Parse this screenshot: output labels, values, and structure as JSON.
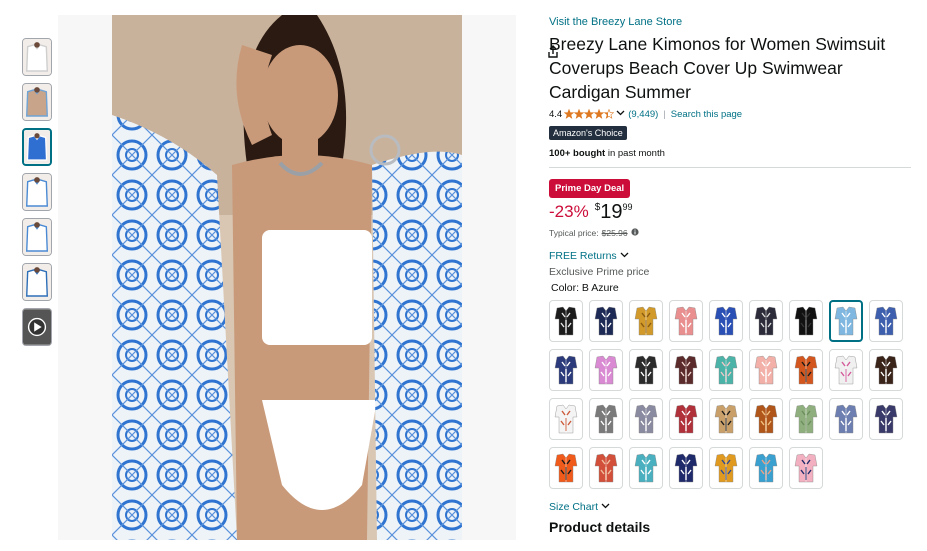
{
  "store_link": "Visit the Breezy Lane Store",
  "title": "Breezy Lane Kimonos for Women Swimsuit Coverups Beach Cover Up Swimwear Cardigan Summer",
  "rating": {
    "value": "4.4",
    "stars": 4.4,
    "count": "(9,449)",
    "search_link": "Search this page"
  },
  "badge": "Amazon's Choice",
  "bought": {
    "bold": "100+ bought",
    "rest": " in past month"
  },
  "deal_badge": "Prime Day Deal",
  "price": {
    "discount": "-23%",
    "currency": "$",
    "whole": "19",
    "fraction": "99"
  },
  "typical": {
    "label": "Typical price:",
    "value": "$25.96"
  },
  "returns": "FREE Returns",
  "exclusive": "Exclusive Prime price",
  "color_label": "Color: B Azure",
  "size_chart": "Size Chart",
  "product_details": "Product details",
  "colors": {
    "brand_link": "#007185",
    "deal_red": "#cc0c39",
    "choice_bg": "#232f3e",
    "star": "#de7921"
  },
  "thumbnails": [
    {
      "name": "thumb-1",
      "main": "#ffffff",
      "accent": "#cfcfcf"
    },
    {
      "name": "thumb-2",
      "main": "#c8a58a",
      "accent": "#6fa3d6"
    },
    {
      "name": "thumb-3",
      "main": "#2f6fd1",
      "accent": "#ffffff",
      "active": true
    },
    {
      "name": "thumb-4",
      "main": "#ffffff",
      "accent": "#4a8ad4"
    },
    {
      "name": "thumb-5",
      "main": "#ffffff",
      "accent": "#4a8ad4"
    },
    {
      "name": "thumb-6",
      "main": "#ffffff",
      "accent": "#2d6eb8"
    },
    {
      "name": "thumb-video",
      "main": "#555555",
      "accent": "#ffffff",
      "video": true
    }
  ],
  "swatches": [
    {
      "main": "#1c1c1c",
      "accent": "#e6e6e6"
    },
    {
      "main": "#1d2a55",
      "accent": "#ffffff"
    },
    {
      "main": "#d19a2a",
      "accent": "#8a5a10"
    },
    {
      "main": "#e98f8f",
      "accent": "#ffffff"
    },
    {
      "main": "#2a4fb5",
      "accent": "#ffffff"
    },
    {
      "main": "#2b2b3a",
      "accent": "#d9d9d9"
    },
    {
      "main": "#111111",
      "accent": "#333333"
    },
    {
      "main": "#7fb7e0",
      "accent": "#ffffff",
      "selected": true
    },
    {
      "main": "#3d5fae",
      "accent": "#ffffff"
    },
    {
      "main": "#2a3a7a",
      "accent": "#ffffff"
    },
    {
      "main": "#d98ad2",
      "accent": "#ffffff"
    },
    {
      "main": "#2b2b2b",
      "accent": "#ffffff"
    },
    {
      "main": "#5b2a2a",
      "accent": "#f0d6cf"
    },
    {
      "main": "#4bb3a8",
      "accent": "#f3c6c6"
    },
    {
      "main": "#f2b0a8",
      "accent": "#ffffff"
    },
    {
      "main": "#d2561d",
      "accent": "#1a1a1a"
    },
    {
      "main": "#f0f0f0",
      "accent": "#d45a9a"
    },
    {
      "main": "#3a241a",
      "accent": "#ffffff"
    },
    {
      "main": "#f4f4f4",
      "accent": "#cc5a3a"
    },
    {
      "main": "#7a7a7a",
      "accent": "#ffffff"
    },
    {
      "main": "#8a8aa0",
      "accent": "#ffffff"
    },
    {
      "main": "#b0313a",
      "accent": "#ffffff"
    },
    {
      "main": "#c9a06a",
      "accent": "#1a1a1a"
    },
    {
      "main": "#b0561a",
      "accent": "#f0c080"
    },
    {
      "main": "#8fb07e",
      "accent": "#6d8d5e"
    },
    {
      "main": "#6d7fb0",
      "accent": "#ffffff"
    },
    {
      "main": "#3a3a6a",
      "accent": "#ffffff"
    },
    {
      "main": "#f05a1a",
      "accent": "#1a1a1a"
    },
    {
      "main": "#d2503a",
      "accent": "#f0c0a0"
    },
    {
      "main": "#4ab0c0",
      "accent": "#ffffff"
    },
    {
      "main": "#1f2a6a",
      "accent": "#ffffff"
    },
    {
      "main": "#e09a20",
      "accent": "#2a4a9a"
    },
    {
      "main": "#3aa0d0",
      "accent": "#f0a080"
    },
    {
      "main": "#f2b0c0",
      "accent": "#1f2a6a"
    }
  ]
}
